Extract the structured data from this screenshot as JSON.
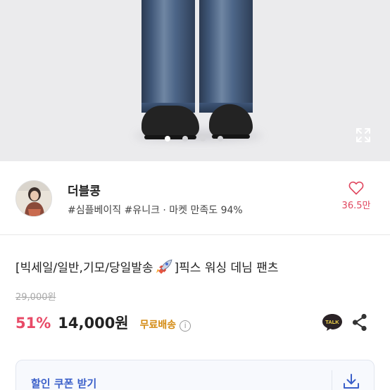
{
  "product_image": {
    "carousel_dots": 4,
    "active_dot": 0,
    "expand_icon": "expand-icon"
  },
  "shop": {
    "name": "더블콩",
    "tags": "#심플베이직 #유니크 · 마켓 만족도 94%",
    "like_count": "36.5만",
    "like_icon": "heart-icon"
  },
  "product": {
    "title_before": "[빅세일/일반,기모/당일발송",
    "title_emoji": "rocket-icon",
    "title_after": "]픽스 워싱 데님 팬츠",
    "original_price": "29,000원",
    "discount": "51%",
    "price": "14,000원",
    "shipping": "무료배송"
  },
  "actions": {
    "talk_label": "TALK",
    "share_icon": "share-icon"
  },
  "coupon": {
    "label": "할인 쿠폰 받기",
    "download_icon": "download-icon"
  },
  "colors": {
    "accent_pink": "#e84a67",
    "shipping_orange": "#d38a12",
    "coupon_blue": "#3a5fc9"
  }
}
